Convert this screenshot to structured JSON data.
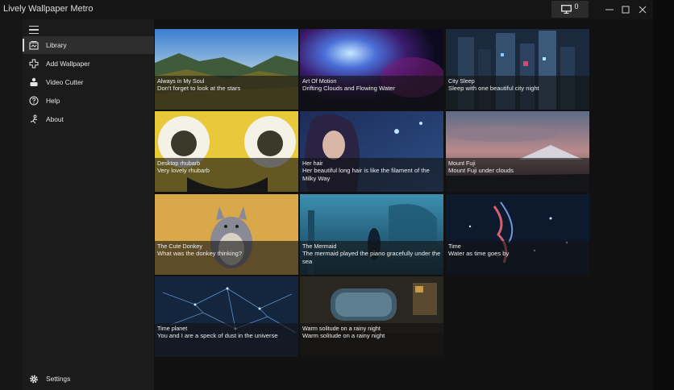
{
  "window": {
    "title": "Lively Wallpaper Metro",
    "screen_count": "0",
    "minimize_glyph": "—",
    "maximize_glyph": "☐",
    "close_glyph": "✕"
  },
  "sidebar": {
    "items": [
      {
        "label": "Library",
        "icon": "library-icon",
        "active": true
      },
      {
        "label": "Add Wallpaper",
        "icon": "add-icon",
        "active": false
      },
      {
        "label": "Video Cutter",
        "icon": "video-cutter-icon",
        "active": false
      },
      {
        "label": "Help",
        "icon": "help-icon",
        "active": false
      },
      {
        "label": "About",
        "icon": "about-icon",
        "active": false
      }
    ],
    "settings_label": "Settings"
  },
  "library": {
    "wallpapers": [
      {
        "title": "Always in My Soul",
        "description": "Don't forget to look at the stars"
      },
      {
        "title": "Art Of Motion",
        "description": "Drifting Clouds and Flowing Water"
      },
      {
        "title": "City Sleep",
        "description": "Sleep with one beautiful city night"
      },
      {
        "title": "Desktop rhubarb",
        "description": "Very lovely rhubarb"
      },
      {
        "title": "Her hair",
        "description": "Her beautiful long hair is like the filament of the Milky Way"
      },
      {
        "title": "Mount Fuji",
        "description": "Mount Fuji under clouds"
      },
      {
        "title": "The Cute Donkey",
        "description": "What was the donkey thinking?"
      },
      {
        "title": "The Mermaid",
        "description": "The mermaid played the piano gracefully under the sea"
      },
      {
        "title": "Time",
        "description": "Water as time goes by"
      },
      {
        "title": "Time planet",
        "description": "You and I are a speck of dust in the universe"
      },
      {
        "title": "Warm solitude on a rainy night",
        "description": "Warm solitude on a rainy night"
      }
    ]
  },
  "colors": {
    "window_bg": "#161616",
    "sidebar_bg": "#1b1b1b",
    "active_item_bg": "#2e2e2e",
    "content_bg": "#111111"
  }
}
